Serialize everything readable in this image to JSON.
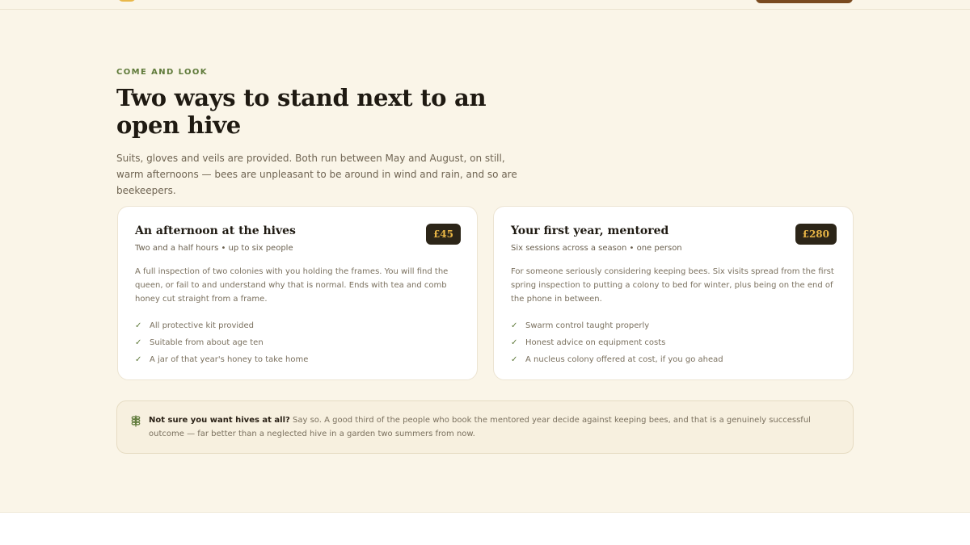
{
  "header": {
    "logo_icon": "bee-logo-icon",
    "cta_color": "#7a4a1f"
  },
  "hero": {
    "eyebrow": "COME AND LOOK",
    "title": "Two ways to stand next to an open hive",
    "intro": "Suits, gloves and veils are provided. Both run between May and August, on still, warm afternoons — bees are unpleasant to be around in wind and rain, and so are beekeepers."
  },
  "cards": [
    {
      "title": "An afternoon at the hives",
      "subtitle": "Two and a half hours • up to six people",
      "price": "£45",
      "description": "A full inspection of two colonies with you holding the frames. You will find the queen, or fail to and understand why that is normal. Ends with tea and comb honey cut straight from a frame.",
      "features": [
        "All protective kit provided",
        "Suitable from about age ten",
        "A jar of that year's honey to take home"
      ]
    },
    {
      "title": "Your first year, mentored",
      "subtitle": "Six sessions across a season • one person",
      "price": "£280",
      "description": "For someone seriously considering keeping bees. Six visits spread from the first spring inspection to putting a colony to bed for winter, plus being on the end of the phone in between.",
      "features": [
        "Swarm control taught properly",
        "Honest advice on equipment costs",
        "A nucleus colony offered at cost, if you go ahead"
      ]
    }
  ],
  "note": {
    "icon": "wheat-icon",
    "lead": "Not sure you want hives at all?",
    "body": " Say so. A good third of the people who book the mentored year decide against keeping bees, and that is a genuinely successful outcome — far better than a neglected hive in a garden two summers from now."
  },
  "colors": {
    "accent": "#5f7a3a",
    "price_bg": "#2c2518",
    "price_text": "#e8b545",
    "background": "#faf5e8"
  }
}
